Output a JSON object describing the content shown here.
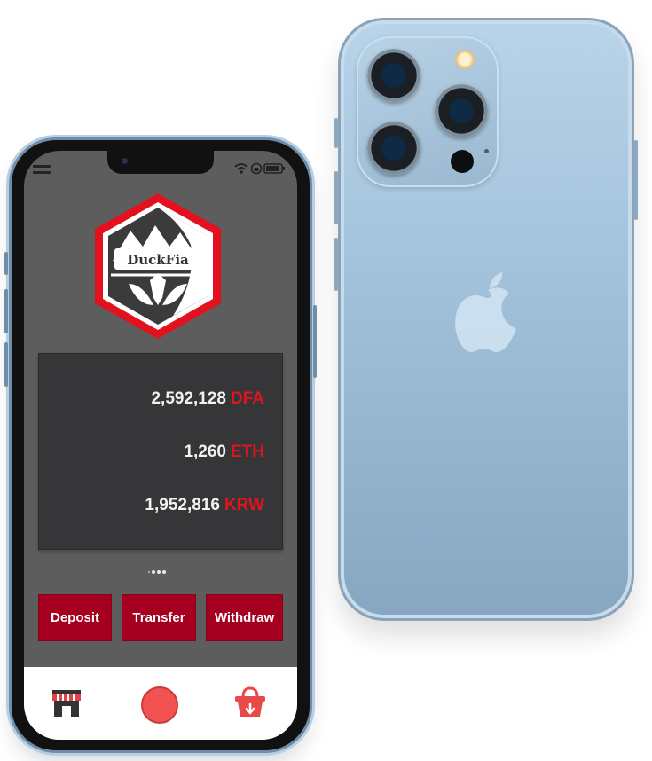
{
  "app": {
    "logo_text": "DuckFia"
  },
  "balances": [
    {
      "amount": "2,592,128",
      "unit": "DFA"
    },
    {
      "amount": "1,260",
      "unit": "ETH"
    },
    {
      "amount": "1,952,816",
      "unit": "KRW"
    }
  ],
  "actions": {
    "deposit_label": "Deposit",
    "transfer_label": "Transfer",
    "withdraw_label": "Withdraw"
  },
  "tabbar": {
    "items": [
      {
        "icon": "shop-icon"
      },
      {
        "icon": "record-button"
      },
      {
        "icon": "basket-download-icon"
      }
    ]
  },
  "colors": {
    "accent_red": "#e0141f",
    "button_red": "#a5001f",
    "screen_bg": "#5d5d5d",
    "card_bg": "#363638",
    "back_phone_blue": "#a9c6de"
  }
}
